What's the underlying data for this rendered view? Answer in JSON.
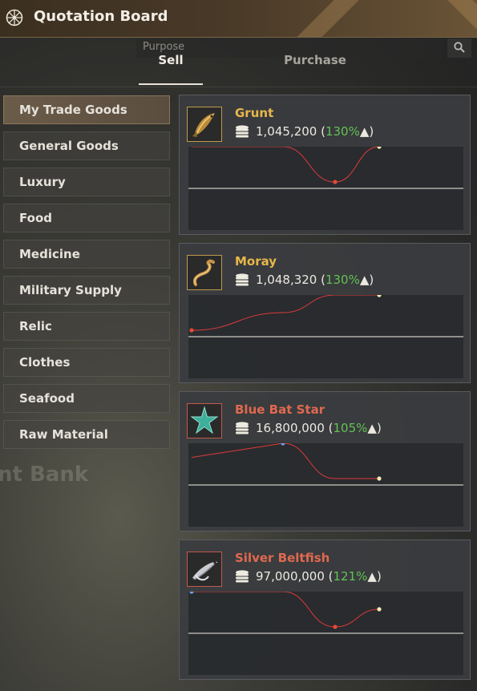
{
  "window": {
    "title": "Quotation Board"
  },
  "search": {
    "placeholder": "Purpose"
  },
  "tabs": [
    {
      "label": "Sell",
      "active": true
    },
    {
      "label": "Purchase",
      "active": false
    }
  ],
  "background_text": "nt Bank",
  "categories": [
    {
      "label": "My Trade Goods",
      "active": true
    },
    {
      "label": "General Goods"
    },
    {
      "label": "Luxury"
    },
    {
      "label": "Food"
    },
    {
      "label": "Medicine"
    },
    {
      "label": "Military Supply"
    },
    {
      "label": "Relic"
    },
    {
      "label": "Clothes"
    },
    {
      "label": "Seafood"
    },
    {
      "label": "Raw Material"
    }
  ],
  "colors": {
    "name_gold": "#e8b74a",
    "name_red": "#e0694f",
    "percent_green": "#63c253",
    "trend_line": "#e03a3a",
    "baseline": "#f2efe6",
    "point_yellow": "#f3ecb0",
    "point_red": "#e24b3b",
    "point_blue": "#6ea1ef"
  },
  "items": [
    {
      "name": "Grunt",
      "name_color": "gold",
      "icon": "grunt-fish-icon",
      "price": "1,045,200",
      "percent": "130%",
      "arrow": "▲",
      "trend": [
        1.0,
        1.0,
        0.0,
        1.0
      ],
      "points": [
        {
          "i": 2,
          "color": "red"
        },
        {
          "i": 3,
          "color": "yellow"
        }
      ]
    },
    {
      "name": "Moray",
      "name_color": "gold",
      "icon": "moray-eel-icon",
      "price": "1,048,320",
      "percent": "130%",
      "arrow": "▲",
      "trend": [
        0.0,
        0.5,
        1.0,
        1.0
      ],
      "points": [
        {
          "i": 0,
          "color": "red"
        },
        {
          "i": 3,
          "color": "yellow"
        }
      ]
    },
    {
      "name": "Blue Bat Star",
      "name_color": "red",
      "icon": "starfish-icon",
      "price": "16,800,000",
      "percent": "105%",
      "arrow": "▲",
      "trend": [
        0.6,
        1.0,
        0.0,
        0.0
      ],
      "points": [
        {
          "i": 1,
          "color": "blue"
        },
        {
          "i": 3,
          "color": "yellow"
        }
      ]
    },
    {
      "name": "Silver Beltfish",
      "name_color": "red",
      "icon": "beltfish-icon",
      "price": "97,000,000",
      "percent": "121%",
      "arrow": "▲",
      "trend": [
        1.0,
        1.0,
        0.0,
        0.5
      ],
      "points": [
        {
          "i": 0,
          "color": "blue"
        },
        {
          "i": 2,
          "color": "red"
        },
        {
          "i": 3,
          "color": "yellow"
        }
      ]
    }
  ]
}
